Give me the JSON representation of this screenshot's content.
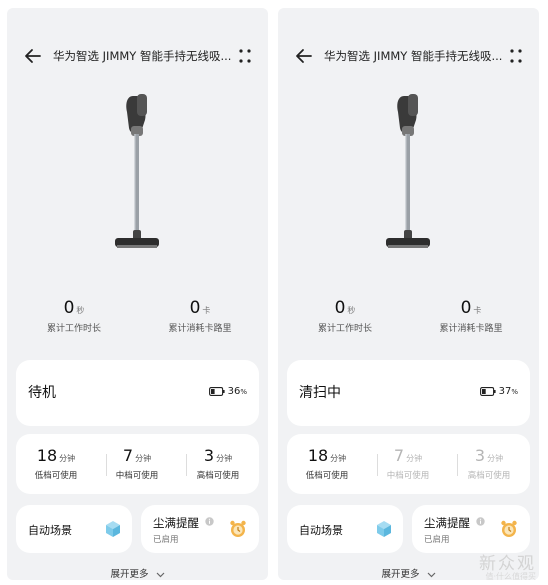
{
  "screens": [
    {
      "title": "华为智选 JIMMY 智能手持无线吸...",
      "stats": [
        {
          "value": "0",
          "unit": "秒",
          "label": "累计工作时长"
        },
        {
          "value": "0",
          "unit": "卡",
          "label": "累计消耗卡路里"
        }
      ],
      "status": "待机",
      "battery": {
        "value": "36",
        "unit": "%",
        "level": 0.36
      },
      "modes": [
        {
          "value": "18",
          "unit": "分钟",
          "label": "低档可使用",
          "active": true
        },
        {
          "value": "7",
          "unit": "分钟",
          "label": "中档可使用",
          "active": true
        },
        {
          "value": "3",
          "unit": "分钟",
          "label": "高档可使用",
          "active": true
        }
      ],
      "scene_label": "自动场景",
      "dust_label": "尘满提醒",
      "dust_status": "已启用",
      "expand_label": "展开更多"
    },
    {
      "title": "华为智选 JIMMY 智能手持无线吸...",
      "stats": [
        {
          "value": "0",
          "unit": "秒",
          "label": "累计工作时长"
        },
        {
          "value": "0",
          "unit": "卡",
          "label": "累计消耗卡路里"
        }
      ],
      "status": "清扫中",
      "battery": {
        "value": "37",
        "unit": "%",
        "level": 0.37
      },
      "modes": [
        {
          "value": "18",
          "unit": "分钟",
          "label": "低档可使用",
          "active": true
        },
        {
          "value": "7",
          "unit": "分钟",
          "label": "中档可使用",
          "active": false
        },
        {
          "value": "3",
          "unit": "分钟",
          "label": "高档可使用",
          "active": false
        }
      ],
      "scene_label": "自动场景",
      "dust_label": "尘满提醒",
      "dust_status": "已启用",
      "expand_label": "展开更多"
    }
  ],
  "watermark": {
    "text": "新众观",
    "sub": "值·什么值得买"
  },
  "colors": {
    "background": "#f1f2f4",
    "card": "#ffffff",
    "cube": "#7ecbea",
    "alarm": "#f3b44b",
    "dim_text": "#b5b5b5"
  },
  "icons": [
    "back-arrow-icon",
    "more-dots-icon",
    "battery-icon",
    "cube-icon",
    "info-icon",
    "alarm-clock-icon",
    "chevron-down-icon"
  ]
}
